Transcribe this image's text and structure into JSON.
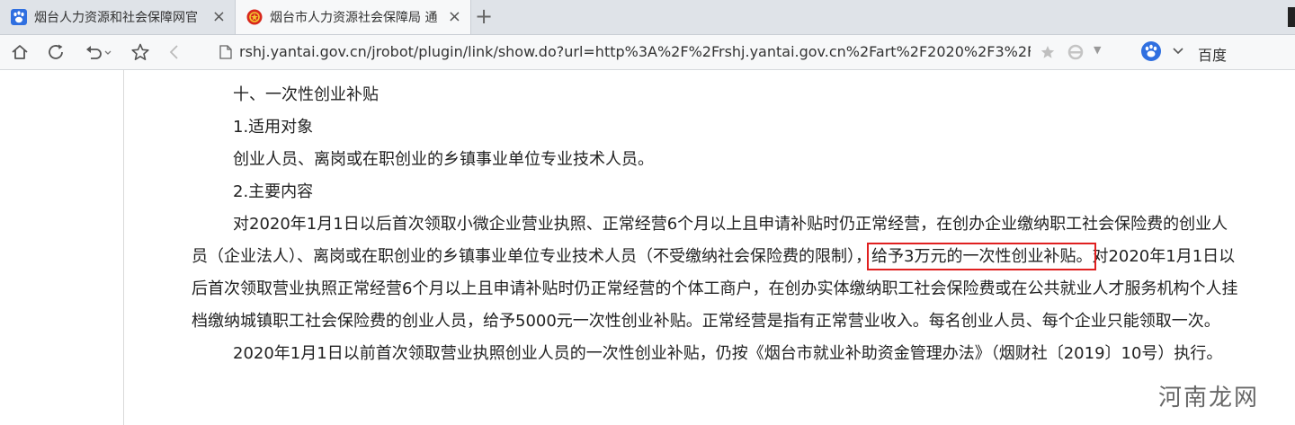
{
  "tabs": [
    {
      "title": "烟台人力资源和社会保障网官",
      "close": "×",
      "favicon": "baidu-paw-icon"
    },
    {
      "title": "烟台市人力资源社会保障局 通",
      "close": "×",
      "favicon": "emblem-icon"
    }
  ],
  "new_tab": "+",
  "address_bar": {
    "url": "rshj.yantai.gov.cn/jrobot/plugin/link/show.do?url=http%3A%2F%2Frshj.yantai.gov.cn%2Fart%2F2020%2F3%2F",
    "drop": "▼"
  },
  "search": {
    "engine_label": "百度",
    "icon": "baidu-paw-icon"
  },
  "article": {
    "heading": "十、一次性创业补贴",
    "section1": "1.适用对象",
    "scope": "创业人员、离岗或在职创业的乡镇事业单位专业技术人员。",
    "section2": "2.主要内容",
    "p1_before": "对2020年1月1日以后首次领取小微企业营业执照、正常经营6个月以上且申请补贴时仍正常经营，在创办企业缴纳职工社会保险费的创业人员（企业法人）、离岗或在职创业的乡镇事业单位专业技术人员（不受缴纳社会保险费的限制），",
    "p1_highlight": "给予3万元的一次性创业补贴。",
    "p1_after": "对2020年1月1日以后首次领取营业执照正常经营6个月以上且申请补贴时仍正常经营的个体工商户，在创办实体缴纳职工社会保险费或在公共就业人才服务机构个人挂档缴纳城镇职工社会保险费的创业人员，给予5000元一次性创业补贴。正常经营是指有正常营业收入。每名创业人员、每个企业只能领取一次。",
    "p2": "2020年1月1日以前首次领取营业执照创业人员的一次性创业补贴，仍按《烟台市就业补助资金管理办法》（烟财社〔2019〕10号）执行。"
  },
  "watermark": "河南龙网",
  "colors": {
    "highlight_box": "#e02020",
    "tabbar": "#dfe3e8",
    "toolbar": "#f7f8f9"
  }
}
